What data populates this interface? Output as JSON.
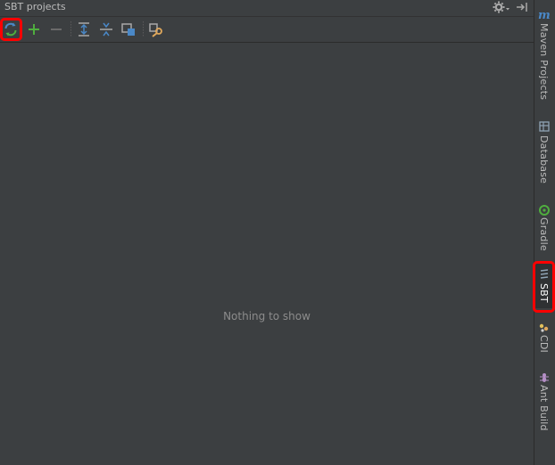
{
  "panel": {
    "title": "SBT projects",
    "empty_text": "Nothing to show"
  },
  "titlebar": {
    "icons": [
      "gear-icon",
      "hide-panel-icon"
    ]
  },
  "toolbar": {
    "buttons": [
      {
        "name": "refresh-all-projects",
        "icon": "refresh-icon"
      },
      {
        "name": "add-project",
        "icon": "plus-icon"
      },
      {
        "name": "remove-project",
        "icon": "minus-icon"
      },
      {
        "name": "expand-all",
        "icon": "expand-all-icon"
      },
      {
        "name": "collapse-all",
        "icon": "collapse-all-icon"
      },
      {
        "name": "attach-project",
        "icon": "attach-icon"
      },
      {
        "name": "settings",
        "icon": "wrench-icon"
      }
    ]
  },
  "right_stripe": {
    "tabs": [
      {
        "label": "Maven Projects",
        "icon": "maven-icon"
      },
      {
        "label": "Database",
        "icon": "database-icon"
      },
      {
        "label": "Gradle",
        "icon": "gradle-icon"
      },
      {
        "label": "SBT",
        "icon": "sbt-icon"
      },
      {
        "label": "CDI",
        "icon": "cdi-icon"
      },
      {
        "label": "Ant Build",
        "icon": "ant-icon"
      }
    ]
  },
  "colors": {
    "background": "#3c3f41",
    "text": "#bbbbbb",
    "accent_green": "#4fae3e",
    "accent_blue": "#4a88c7",
    "highlight": "#ff0000"
  }
}
